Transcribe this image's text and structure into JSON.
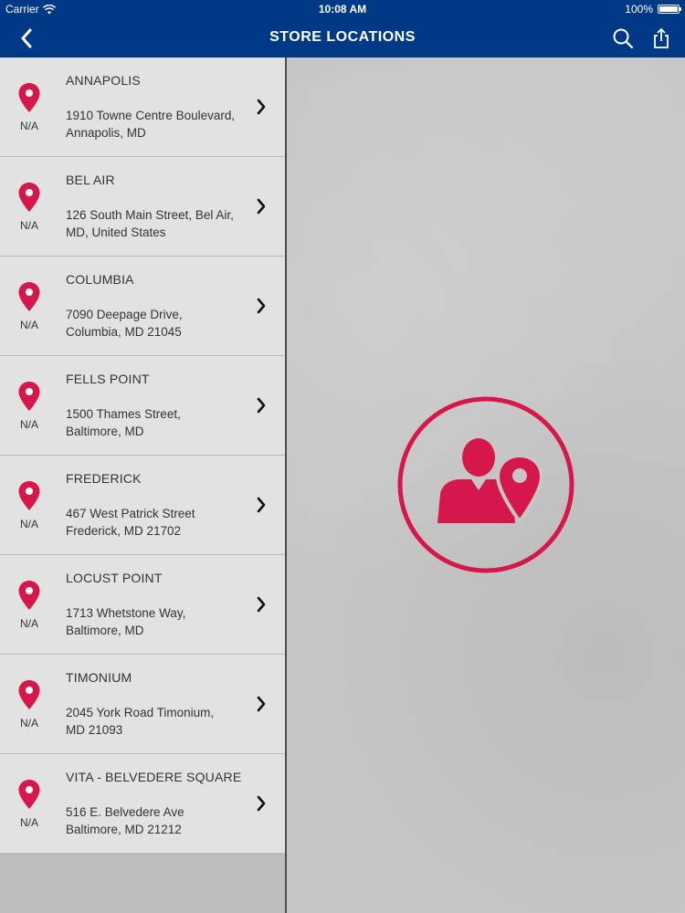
{
  "status_bar": {
    "carrier": "Carrier",
    "time": "10:08 AM",
    "battery": "100%"
  },
  "nav": {
    "title": "STORE LOCATIONS",
    "back_icon": "chevron-left-icon",
    "search_icon": "search-icon",
    "share_icon": "share-icon"
  },
  "colors": {
    "nav_bg": "#003a87",
    "accent": "#d6174b",
    "list_bg": "#e2e2e2",
    "pane_bg": "#c6c6c6"
  },
  "stores": [
    {
      "name": "ANNAPOLIS",
      "address_line1": "1910 Towne Centre Boulevard,",
      "address_line2": "Annapolis, MD",
      "distance": "N/A"
    },
    {
      "name": "BEL AIR",
      "address_line1": "126 South Main Street, Bel Air,",
      "address_line2": "MD, United States",
      "distance": "N/A"
    },
    {
      "name": "COLUMBIA",
      "address_line1": "7090 Deepage Drive,",
      "address_line2": "Columbia, MD 21045",
      "distance": "N/A"
    },
    {
      "name": "FELLS POINT",
      "address_line1": "1500 Thames Street,",
      "address_line2": "Baltimore, MD",
      "distance": "N/A"
    },
    {
      "name": "FREDERICK",
      "address_line1": "467 West Patrick Street",
      "address_line2": "Frederick, MD 21702",
      "distance": "N/A"
    },
    {
      "name": "LOCUST POINT",
      "address_line1": "1713 Whetstone Way,",
      "address_line2": "Baltimore, MD",
      "distance": "N/A"
    },
    {
      "name": "TIMONIUM",
      "address_line1": "2045 York Road Timonium,",
      "address_line2": "MD 21093",
      "distance": "N/A"
    },
    {
      "name": "VITA - BELVEDERE SQUARE",
      "address_line1": "516 E. Belvedere Ave",
      "address_line2": "Baltimore, MD 21212",
      "distance": "N/A"
    }
  ],
  "detail": {
    "emblem_icon": "person-location-icon"
  }
}
